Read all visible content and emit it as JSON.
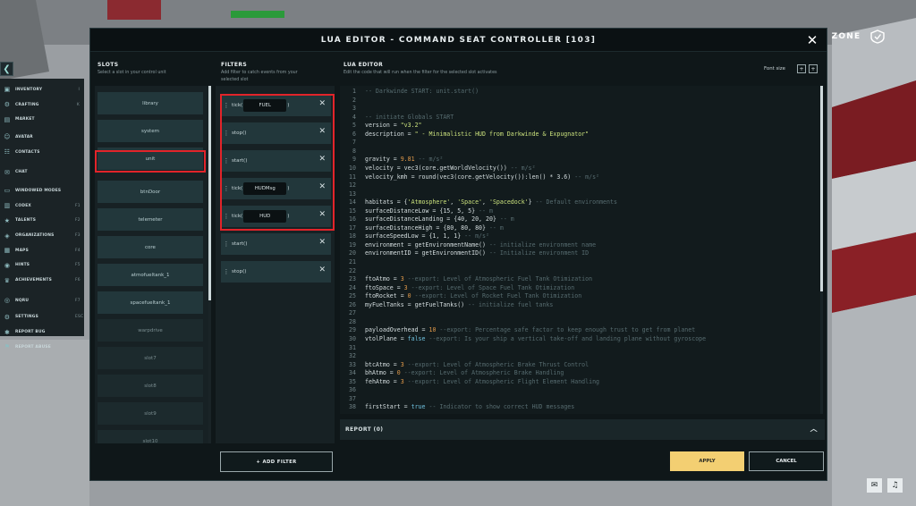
{
  "window": {
    "title": "LUA EDITOR - COMMAND SEAT CONTROLLER [103]",
    "close_icon": "close-icon"
  },
  "zone": {
    "label": "E ZONE",
    "icon": "shield-icon"
  },
  "sidebar": {
    "items": [
      {
        "label": "INVENTORY",
        "key": "I",
        "icon": "box-icon"
      },
      {
        "label": "CRAFTING",
        "key": "K",
        "icon": "gear-icon"
      },
      {
        "label": "MARKET",
        "key": "",
        "icon": "cart-icon"
      },
      {
        "label": "AVATAR",
        "key": "",
        "icon": "user-icon"
      },
      {
        "label": "CONTACTS",
        "key": "",
        "icon": "contacts-icon"
      },
      {
        "label": "CHAT",
        "key": "",
        "icon": "chat-icon"
      },
      {
        "label": "WINDOWED MODES",
        "key": "",
        "icon": "window-icon"
      },
      {
        "label": "CODEX",
        "key": "F1",
        "icon": "book-icon"
      },
      {
        "label": "TALENTS",
        "key": "F2",
        "icon": "star-icon"
      },
      {
        "label": "ORGANIZATIONS",
        "key": "F3",
        "icon": "org-icon"
      },
      {
        "label": "MAPS",
        "key": "F4",
        "icon": "map-icon"
      },
      {
        "label": "HINTS",
        "key": "F5",
        "icon": "hint-icon"
      },
      {
        "label": "ACHIEVEMENTS",
        "key": "F6",
        "icon": "trophy-icon"
      },
      {
        "label": "NQRU",
        "key": "F7",
        "icon": "nq-icon"
      },
      {
        "label": "SETTINGS",
        "key": "ESC",
        "icon": "settings-icon"
      },
      {
        "label": "REPORT BUG",
        "key": "",
        "icon": "bug-icon"
      },
      {
        "label": "REPORT ABUSE",
        "key": "",
        "icon": "flag-icon"
      }
    ]
  },
  "slots": {
    "heading": "SLOTS",
    "subtitle": "Select a slot in your control unit",
    "items": [
      "library",
      "system",
      "unit",
      "btnDoor",
      "telemeter",
      "core",
      "atmofueltank_1",
      "spacefueltank_1",
      "warpdrive",
      "slot7",
      "slot8",
      "slot9",
      "slot10"
    ],
    "selected": "unit"
  },
  "filters": {
    "heading": "FILTERS",
    "subtitle_line1": "Add filter to catch events from your",
    "subtitle_line2": "selected slot",
    "items": [
      {
        "name": "tick(",
        "arg": "FUEL",
        "close": ")"
      },
      {
        "name": "stop()",
        "arg": "",
        "close": ""
      },
      {
        "name": "start()",
        "arg": "",
        "close": ""
      },
      {
        "name": "tick(",
        "arg": "HUDMsg",
        "close": ")"
      },
      {
        "name": "tick(",
        "arg": "HUD",
        "close": ")"
      },
      {
        "name": "start()",
        "arg": "",
        "close": ""
      },
      {
        "name": "stop()",
        "arg": "",
        "close": ""
      }
    ],
    "add_label": "+ ADD FILTER"
  },
  "editor": {
    "heading": "LUA EDITOR",
    "subtitle": "Edit the code that will run when the filter for the selected slot activates",
    "font_size_label": "Font size",
    "font_minus": "+",
    "font_plus": "+",
    "lines": [
      [
        [
          "cm",
          "-- Darkwinde START: unit.start()"
        ]
      ],
      [],
      [],
      [
        [
          "cm",
          "-- initiate Globals START"
        ]
      ],
      [
        [
          "tx",
          "version = "
        ],
        [
          "st",
          "\"v3.2\""
        ]
      ],
      [
        [
          "tx",
          "description = "
        ],
        [
          "st",
          "\" - Minimalistic HUD from Darkwinde & Expugnator\""
        ]
      ],
      [],
      [],
      [
        [
          "tx",
          "gravity = "
        ],
        [
          "nm",
          "9.81"
        ],
        [
          "cm",
          " -- m/s²"
        ]
      ],
      [
        [
          "tx",
          "velocity = vec3(core.getWorldVelocity()) "
        ],
        [
          "cm",
          "-- m/s²"
        ]
      ],
      [
        [
          "tx",
          "velocity_kmh = round(vec3(core.getVelocity()):len() * 3.6) "
        ],
        [
          "cm",
          "-- m/s²"
        ]
      ],
      [],
      [],
      [
        [
          "tx",
          "habitats = {"
        ],
        [
          "st",
          "'Atmosphere'"
        ],
        [
          "tx",
          ", "
        ],
        [
          "st",
          "'Space'"
        ],
        [
          "tx",
          ", "
        ],
        [
          "st",
          "'Spacedock'"
        ],
        [
          "tx",
          "} "
        ],
        [
          "cm",
          "-- Default environments"
        ]
      ],
      [
        [
          "tx",
          "surfaceDistanceLow = {15, 5, 5} "
        ],
        [
          "cm",
          "-- m"
        ]
      ],
      [
        [
          "tx",
          "surfaceDistanceLanding = {40, 20, 20} "
        ],
        [
          "cm",
          "-- m"
        ]
      ],
      [
        [
          "tx",
          "surfaceDistanceHigh = {80, 80, 80} "
        ],
        [
          "cm",
          "-- m"
        ]
      ],
      [
        [
          "tx",
          "surfaceSpeedLow = {1, 1, 1} "
        ],
        [
          "cm",
          "-- m/s²"
        ]
      ],
      [
        [
          "tx",
          "environment = getEnvironmentName() "
        ],
        [
          "cm",
          "-- initialize environment name"
        ]
      ],
      [
        [
          "tx",
          "environmentID = getEnvironmentID() "
        ],
        [
          "cm",
          "-- Initialize environment ID"
        ]
      ],
      [],
      [],
      [
        [
          "tx",
          "ftoAtmo = "
        ],
        [
          "nm",
          "3"
        ],
        [
          "cm",
          " --export: Level of Atmospheric Fuel Tank Otimization"
        ]
      ],
      [
        [
          "tx",
          "ftoSpace = "
        ],
        [
          "nm",
          "3"
        ],
        [
          "cm",
          " --export: Level of Space Fuel Tank Otimization"
        ]
      ],
      [
        [
          "tx",
          "ftoRocket = "
        ],
        [
          "nm",
          "0"
        ],
        [
          "cm",
          " --export: Level of Rocket Fuel Tank Otimization"
        ]
      ],
      [
        [
          "tx",
          "myFuelTanks = getFuelTanks() "
        ],
        [
          "cm",
          "-- initialize fuel tanks"
        ]
      ],
      [],
      [],
      [
        [
          "tx",
          "payloadOverhead = "
        ],
        [
          "nm",
          "10"
        ],
        [
          "cm",
          " --export: Percentage safe factor to keep enough trust to get from planet"
        ]
      ],
      [
        [
          "tx",
          "vtolPlane = "
        ],
        [
          "kw",
          "false"
        ],
        [
          "cm",
          " --export: Is your ship a vertical take-off and landing plane without gyroscope"
        ]
      ],
      [],
      [],
      [
        [
          "tx",
          "btcAtmo = "
        ],
        [
          "nm",
          "3"
        ],
        [
          "cm",
          " --export: Level of Atmospheric Brake Thrust Control"
        ]
      ],
      [
        [
          "tx",
          "bhAtmo = "
        ],
        [
          "nm",
          "0"
        ],
        [
          "cm",
          " --export: Level of Atmospheric Brake Handling"
        ]
      ],
      [
        [
          "tx",
          "fehAtmo = "
        ],
        [
          "nm",
          "3"
        ],
        [
          "cm",
          " --export: Level of Atmospheric Flight Element Handling"
        ]
      ],
      [],
      [],
      [
        [
          "tx",
          "firstStart = "
        ],
        [
          "kw",
          "true"
        ],
        [
          "cm",
          " -- Indicator to show correct HUD messages"
        ]
      ]
    ]
  },
  "report": {
    "label": "REPORT (0)"
  },
  "buttons": {
    "apply": "APPLY",
    "cancel": "CANCEL"
  },
  "corner": {
    "left_icon": "chat-alert-icon",
    "right_icon": "bell-icon"
  },
  "colors": {
    "highlight": "#e2242a",
    "apply": "#f3cf72",
    "panel": "#0f1719"
  }
}
